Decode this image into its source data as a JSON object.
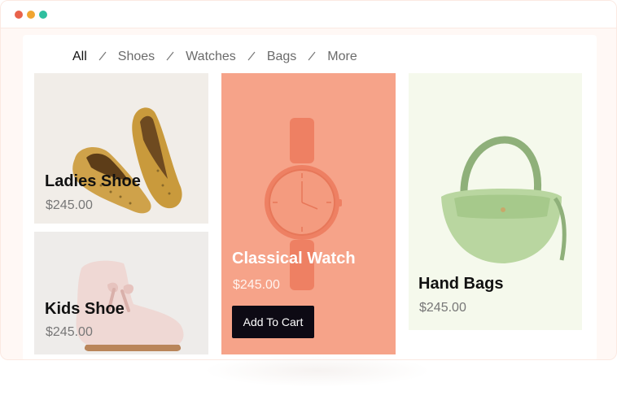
{
  "window": {
    "controls": [
      "close",
      "minimize",
      "maximize"
    ],
    "control_colors": {
      "close": "#e8624b",
      "minimize": "#f1a531",
      "maximize": "#2fbf9f"
    }
  },
  "filters": [
    {
      "label": "All",
      "active": true
    },
    {
      "label": "Shoes",
      "active": false
    },
    {
      "label": "Watches",
      "active": false
    },
    {
      "label": "Bags",
      "active": false
    },
    {
      "label": "More",
      "active": false
    }
  ],
  "products": {
    "ladies_shoe": {
      "name": "Ladies Shoe",
      "price": "$245.00",
      "background": "#f1ede8",
      "icon": "loafer-shoe-icon"
    },
    "kids_shoe": {
      "name": "Kids Shoe",
      "price": "$245.00",
      "background": "#eeecea",
      "icon": "kids-boot-icon"
    },
    "classical_watch": {
      "name": "Classical Watch",
      "price": "$245.00",
      "button_label": "Add To Cart",
      "background": "#f6a389",
      "icon": "wristwatch-icon"
    },
    "hand_bags": {
      "name": "Hand Bags",
      "price": "$245.00",
      "background": "#f5f9ec",
      "icon": "handbag-icon"
    }
  }
}
